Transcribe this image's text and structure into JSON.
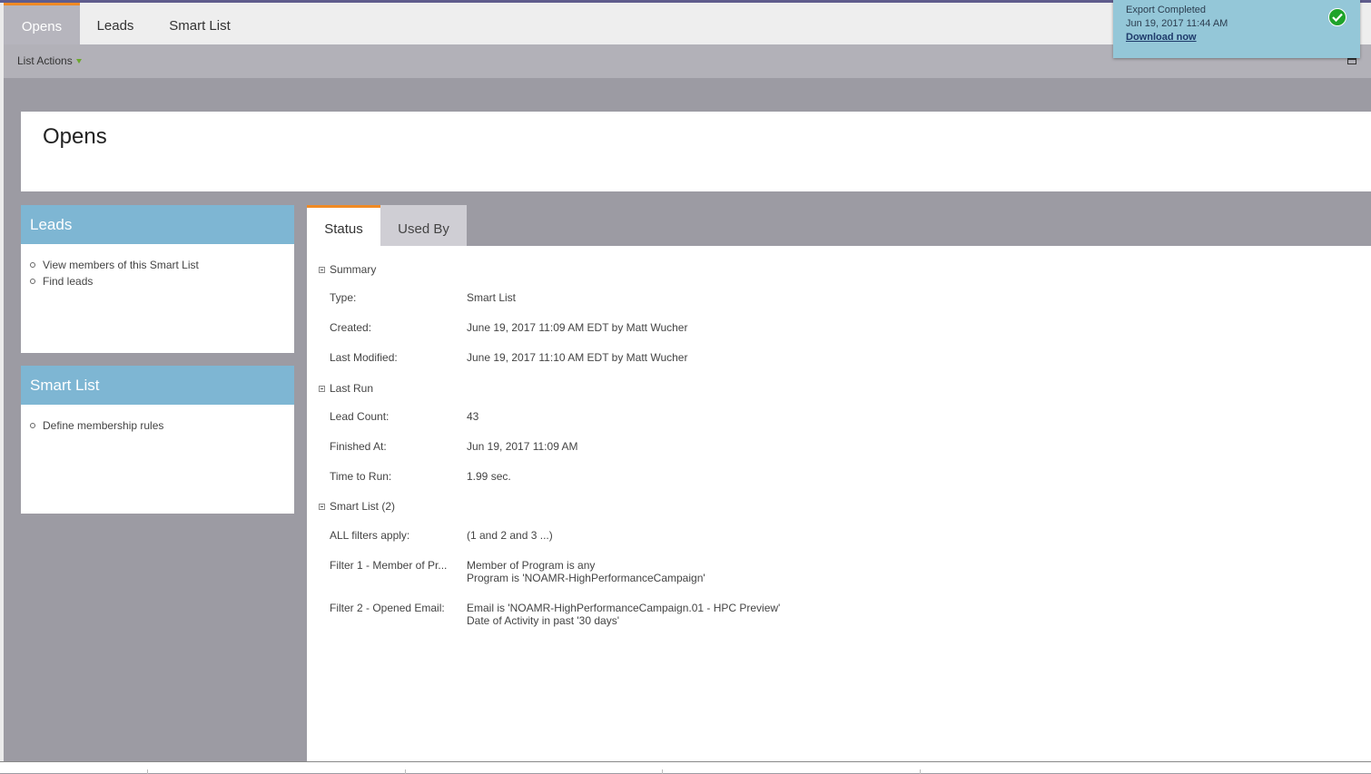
{
  "top_tabs": [
    {
      "label": "Opens"
    },
    {
      "label": "Leads"
    },
    {
      "label": "Smart List"
    }
  ],
  "action_bar": {
    "list_actions": "List Actions"
  },
  "toast": {
    "title": "Export Completed",
    "date": "Jun 19, 2017 11:44 AM",
    "link": "Download now",
    "status_icon": "check-circle-icon"
  },
  "page_title": "Opens",
  "leads_panel": {
    "title": "Leads",
    "items": [
      "View members of this Smart List",
      "Find leads"
    ]
  },
  "smartlist_panel": {
    "title": "Smart List",
    "items": [
      "Define membership rules"
    ]
  },
  "main_tabs": [
    {
      "label": "Status"
    },
    {
      "label": "Used By"
    }
  ],
  "summary": {
    "heading": "Summary",
    "rows": [
      {
        "label": "Type:",
        "value": "Smart List"
      },
      {
        "label": "Created:",
        "value": "June 19, 2017 11:09 AM EDT by Matt Wucher"
      },
      {
        "label": "Last Modified:",
        "value": "June 19, 2017 11:10 AM EDT by Matt Wucher"
      }
    ]
  },
  "last_run": {
    "heading": "Last Run",
    "rows": [
      {
        "label": "Lead Count:",
        "value": "43"
      },
      {
        "label": "Finished At:",
        "value": "Jun 19, 2017 11:09 AM"
      },
      {
        "label": "Time to Run:",
        "value": "1.99 sec."
      }
    ]
  },
  "smart_list": {
    "heading": "Smart List (2)",
    "rows": [
      {
        "label": "ALL filters apply:",
        "value": "(1 and 2 and 3 ...)"
      },
      {
        "label": "Filter 1 - Member of Pr...",
        "value": "Member of Program is any",
        "value2": "Program is 'NOAMR-HighPerformanceCampaign'"
      },
      {
        "label": "Filter 2 - Opened Email:",
        "value": "Email is 'NOAMR-HighPerformanceCampaign.01 - HPC Preview'",
        "value2": "Date of Activity in past '30 days'"
      }
    ]
  },
  "colors": {
    "accent": "#f08a24",
    "panel_header": "#7eb6d3",
    "toast_bg": "#94c7d8",
    "background": "#9c9ba3"
  }
}
